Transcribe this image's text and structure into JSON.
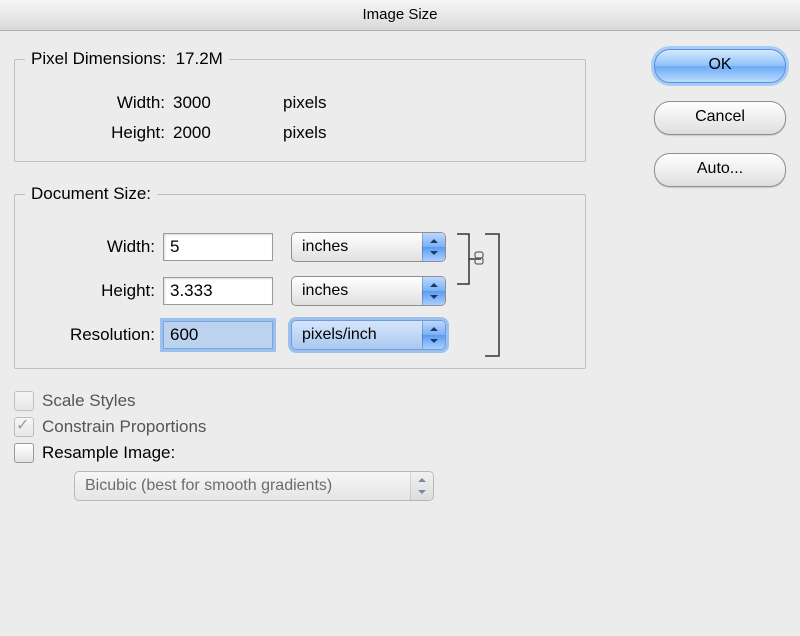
{
  "dialog": {
    "title": "Image Size"
  },
  "pixel_dimensions": {
    "legend_prefix": "Pixel Dimensions:",
    "size": "17.2M",
    "width_label": "Width:",
    "width_value": "3000",
    "width_unit": "pixels",
    "height_label": "Height:",
    "height_value": "2000",
    "height_unit": "pixels"
  },
  "document_size": {
    "legend": "Document Size:",
    "width_label": "Width:",
    "width_value": "5",
    "width_unit": "inches",
    "height_label": "Height:",
    "height_value": "3.333",
    "height_unit": "inches",
    "resolution_label": "Resolution:",
    "resolution_value": "600",
    "resolution_unit": "pixels/inch"
  },
  "options": {
    "scale_styles": {
      "label": "Scale Styles",
      "checked": false,
      "enabled": false
    },
    "constrain_proportions": {
      "label": "Constrain Proportions",
      "checked": true,
      "enabled": false
    },
    "resample_image": {
      "label": "Resample Image:",
      "checked": false,
      "enabled": true
    },
    "resample_method": "Bicubic (best for smooth gradients)"
  },
  "buttons": {
    "ok": "OK",
    "cancel": "Cancel",
    "auto": "Auto..."
  }
}
